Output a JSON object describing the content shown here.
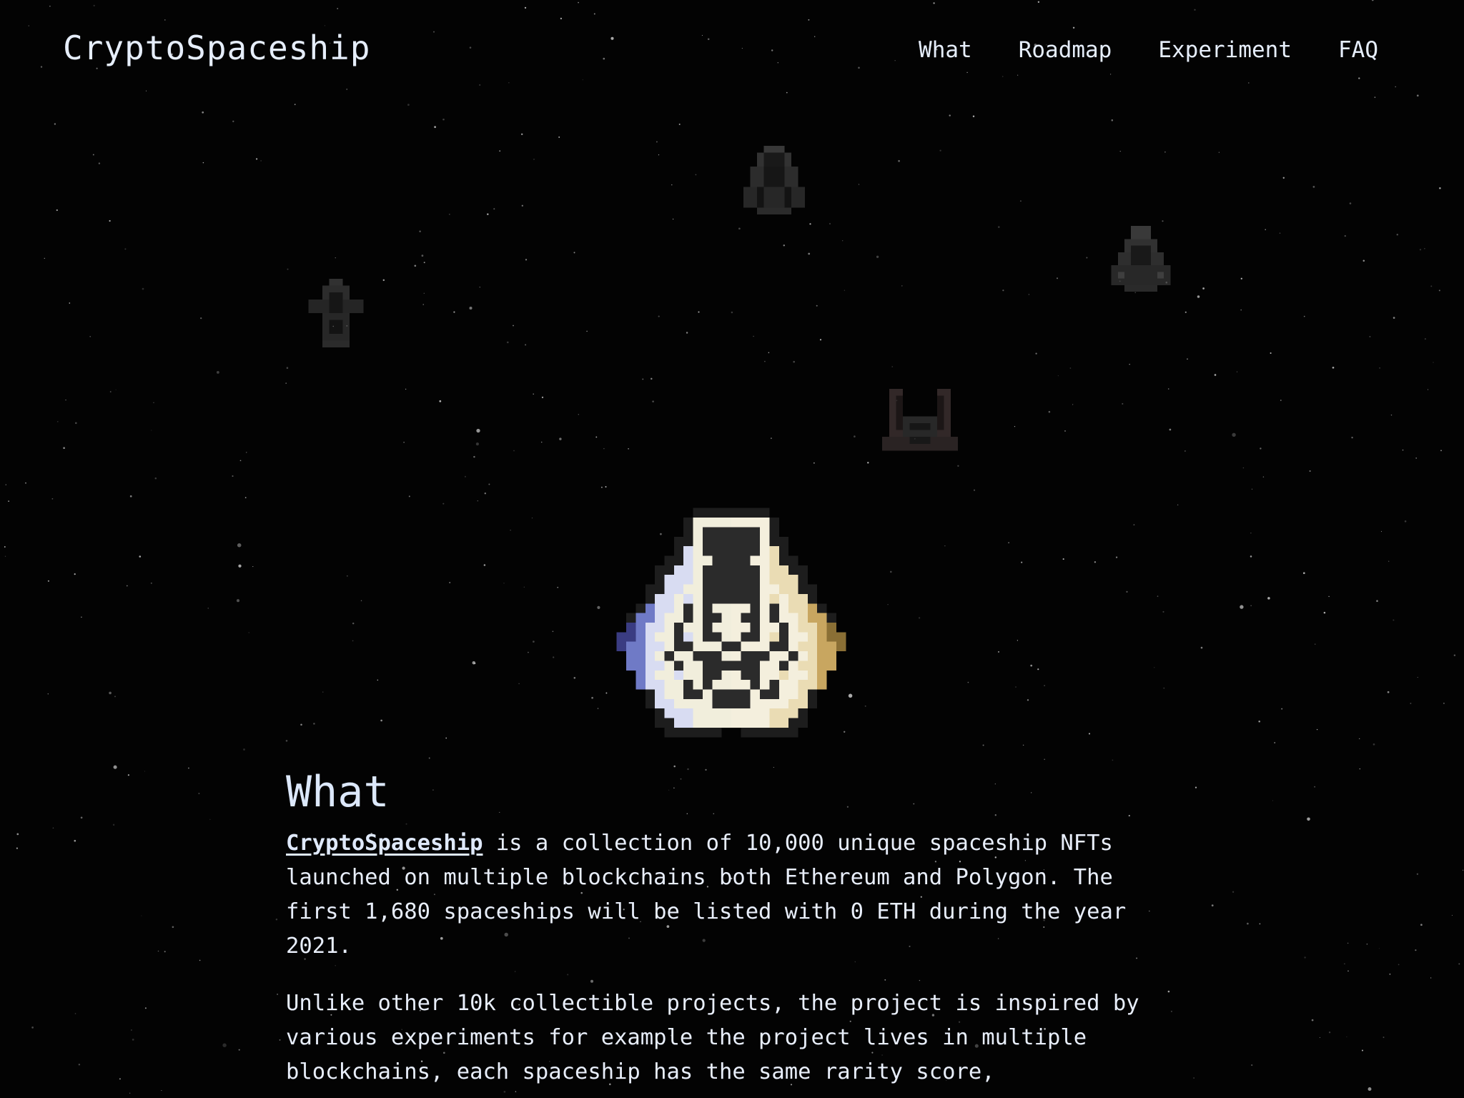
{
  "header": {
    "logo": "CryptoSpaceship",
    "nav": [
      {
        "label": "What"
      },
      {
        "label": "Roadmap"
      },
      {
        "label": "Experiment"
      },
      {
        "label": "FAQ"
      }
    ]
  },
  "what_section": {
    "heading": "What",
    "paragraph1": {
      "link_text": "CryptoSpaceship",
      "rest": " is a collection of 10,000 unique spaceship NFTs launched on multiple blockchains both Ethereum and Polygon. The first 1,680 spaceships will be listed with 0 ETH during the year 2021."
    },
    "paragraph2": "Unlike other 10k collectible projects, the project is inspired by various experiments for example the project lives in multiple blockchains, each spaceship has the same rarity score,"
  },
  "colors": {
    "background": "#030303",
    "text": "#e8eefa",
    "ship_left_wing": "#6f7ac6",
    "ship_right_wing": "#c8a660",
    "ship_light": "#f1eedc"
  },
  "icons": [
    "spaceship-icon"
  ]
}
